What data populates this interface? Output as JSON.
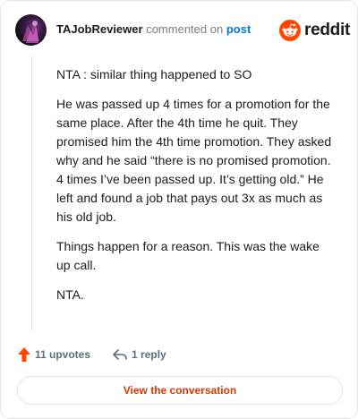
{
  "header": {
    "username": "TAJobReviewer",
    "commented_text": "commented on",
    "post_link": "post",
    "brand_wordmark": "reddit",
    "brand_icon": "reddit-snoo-icon"
  },
  "comment": {
    "paragraphs": [
      "NTA : similar thing happened to SO",
      "He was passed up 4 times for a promotion for the same place. After the 4th time he quit. They promised him the 4th time promotion. They asked why and he said “there is no promised promotion. 4 times I’ve been passed up. It’s getting old.” He left and found a job that pays out 3x as much as his old job.",
      "Things happen for a reason. This was the wake up call.",
      "NTA."
    ]
  },
  "actions": {
    "upvotes_label": "11 upvotes",
    "upvote_icon": "upvote-arrow-icon",
    "reply_label": "1 reply",
    "reply_icon": "reply-arrow-icon"
  },
  "footer": {
    "view_button_label": "View the conversation"
  },
  "colors": {
    "brand_orange": "#ff4500",
    "link_blue": "#0079d3",
    "button_text": "#d93a00",
    "muted": "#576f76"
  }
}
